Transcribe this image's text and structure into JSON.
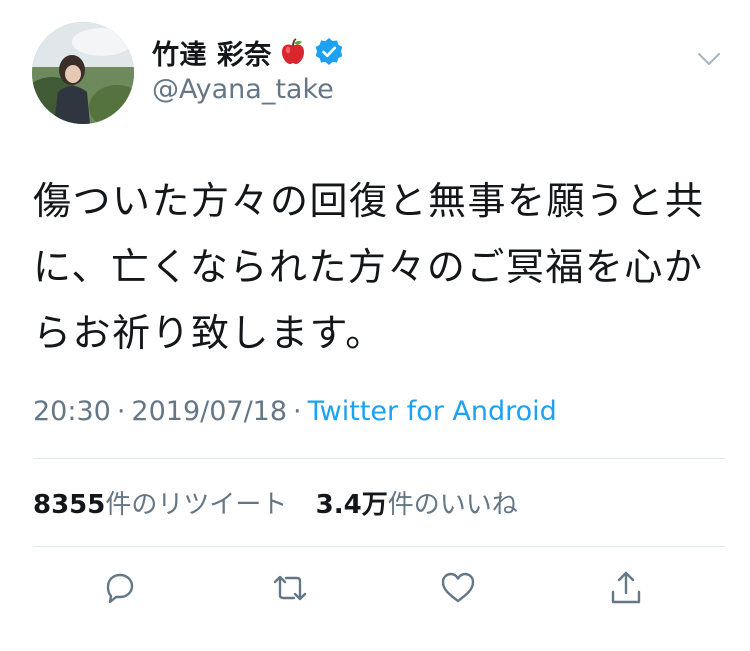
{
  "tweet": {
    "author": {
      "display_name": "竹達 彩奈",
      "handle": "@Ayana_take",
      "verified": true
    },
    "text": "傷ついた方々の回復と無事を願うと共に、亡くなられた方々のご冥福を心からお祈り致します。",
    "time": "20:30",
    "date": "2019/07/18",
    "separator": "·",
    "source": "Twitter for Android",
    "retweets": {
      "count": "8355",
      "label": "件のリツイート"
    },
    "likes": {
      "count": "3.4万",
      "label": "件のいいね"
    }
  },
  "icons": {
    "emoji": "apple-icon",
    "verified": "verified-badge-icon",
    "menu": "chevron-down-icon",
    "reply": "reply-icon",
    "retweet": "retweet-icon",
    "like": "heart-icon",
    "share": "share-icon"
  },
  "colors": {
    "text": "#14171a",
    "secondary": "#657786",
    "link": "#1da1f2",
    "divider": "#e1e8ed",
    "verified": "#1da1f2",
    "icon": "#657786"
  }
}
